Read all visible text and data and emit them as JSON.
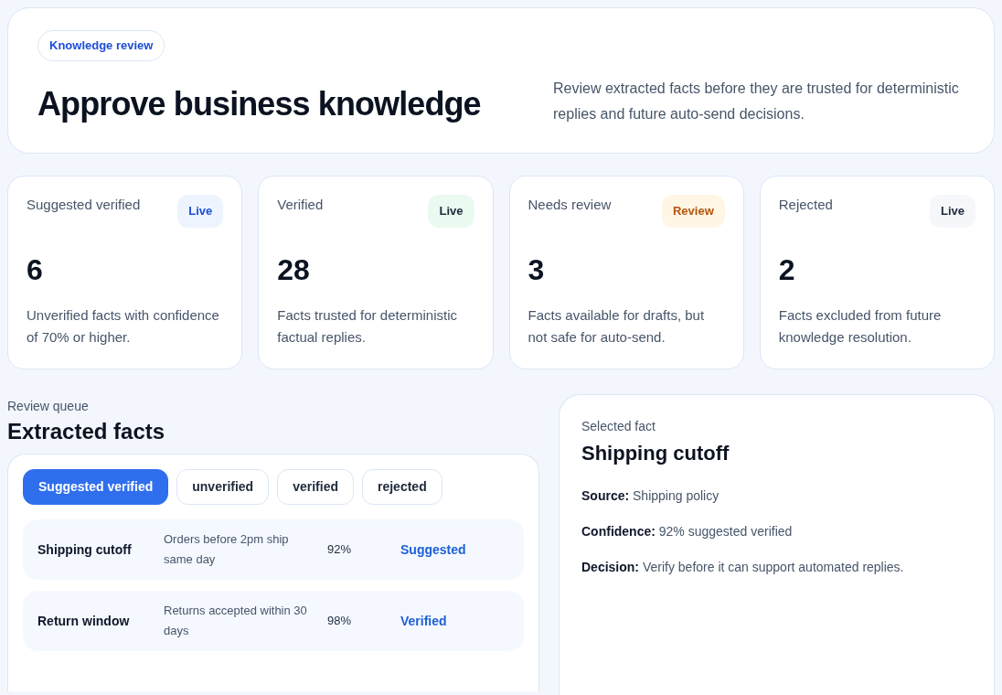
{
  "header": {
    "badge": "Knowledge review",
    "title": "Approve business knowledge",
    "description": "Review extracted facts before they are trusted for deterministic replies and future auto-send decisions."
  },
  "stats": [
    {
      "label": "Suggested verified",
      "badge": "Live",
      "kind": "info",
      "value": "6",
      "note": "Unverified facts with confidence of 70% or higher."
    },
    {
      "label": "Verified",
      "badge": "Live",
      "kind": "success",
      "value": "28",
      "note": "Facts trusted for deterministic factual replies."
    },
    {
      "label": "Needs review",
      "badge": "Review",
      "kind": "warning",
      "value": "3",
      "note": "Facts available for drafts, but not safe for auto-send."
    },
    {
      "label": "Rejected",
      "badge": "Live",
      "kind": "neutral",
      "value": "2",
      "note": "Facts excluded from future knowledge resolution."
    }
  ],
  "queue": {
    "eyebrow": "Review queue",
    "title": "Extracted facts",
    "tabs": [
      {
        "label": "Suggested verified",
        "selected": true
      },
      {
        "label": "unverified",
        "selected": false
      },
      {
        "label": "verified",
        "selected": false
      },
      {
        "label": "rejected",
        "selected": false
      }
    ],
    "rows": [
      {
        "name": "Shipping cutoff",
        "fact": "Orders before 2pm ship same day",
        "confidence": "92%",
        "status": "Suggested"
      },
      {
        "name": "Return window",
        "fact": "Returns accepted within 30 days",
        "confidence": "98%",
        "status": "Verified"
      }
    ]
  },
  "detail": {
    "eyebrow": "Selected fact",
    "title": "Shipping cutoff",
    "fields": [
      {
        "label": "Source:",
        "value": "Shipping policy"
      },
      {
        "label": "Confidence:",
        "value": "92% suggested verified"
      },
      {
        "label": "Decision:",
        "value": "Verify before it can support automated replies."
      }
    ]
  }
}
